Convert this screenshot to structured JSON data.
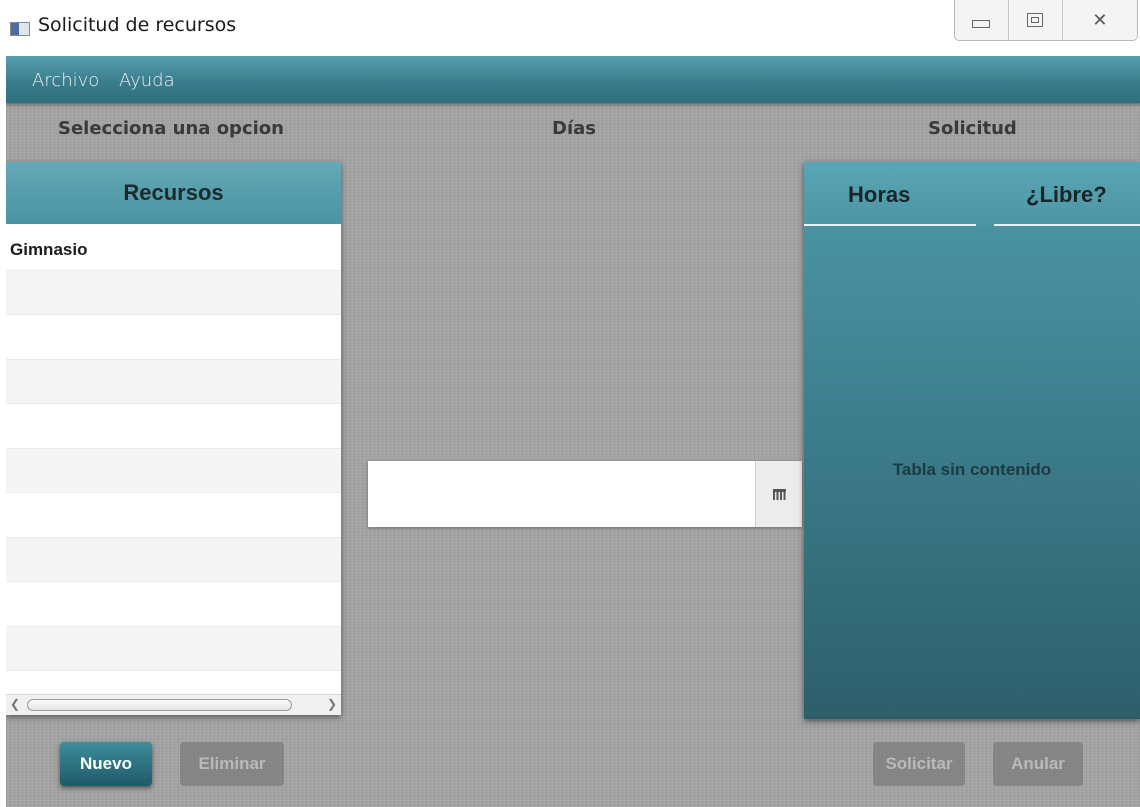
{
  "window": {
    "title": "Solicitud de recursos"
  },
  "menu": {
    "items": [
      "Archivo",
      "Ayuda"
    ]
  },
  "sections": {
    "left": "Selecciona una opcion",
    "center": "Días",
    "right": "Solicitud"
  },
  "resources": {
    "header": "Recursos",
    "items": [
      "Gimnasio"
    ]
  },
  "date_picker": {
    "value": ""
  },
  "schedule": {
    "columns": [
      "Horas",
      "¿Libre?"
    ],
    "empty_message": "Tabla sin contenido"
  },
  "buttons": {
    "nuevo": "Nuevo",
    "eliminar": "Eliminar",
    "solicitar": "Solicitar",
    "anular": "Anular"
  },
  "colors": {
    "accent": "#4a93a2",
    "primary_button": "#2a6f7d",
    "background": "#a3a3a3"
  },
  "icons": [
    "app-icon",
    "minimize-icon",
    "maximize-icon",
    "close-icon",
    "calendar-icon",
    "scroll-left-icon",
    "scroll-right-icon"
  ]
}
